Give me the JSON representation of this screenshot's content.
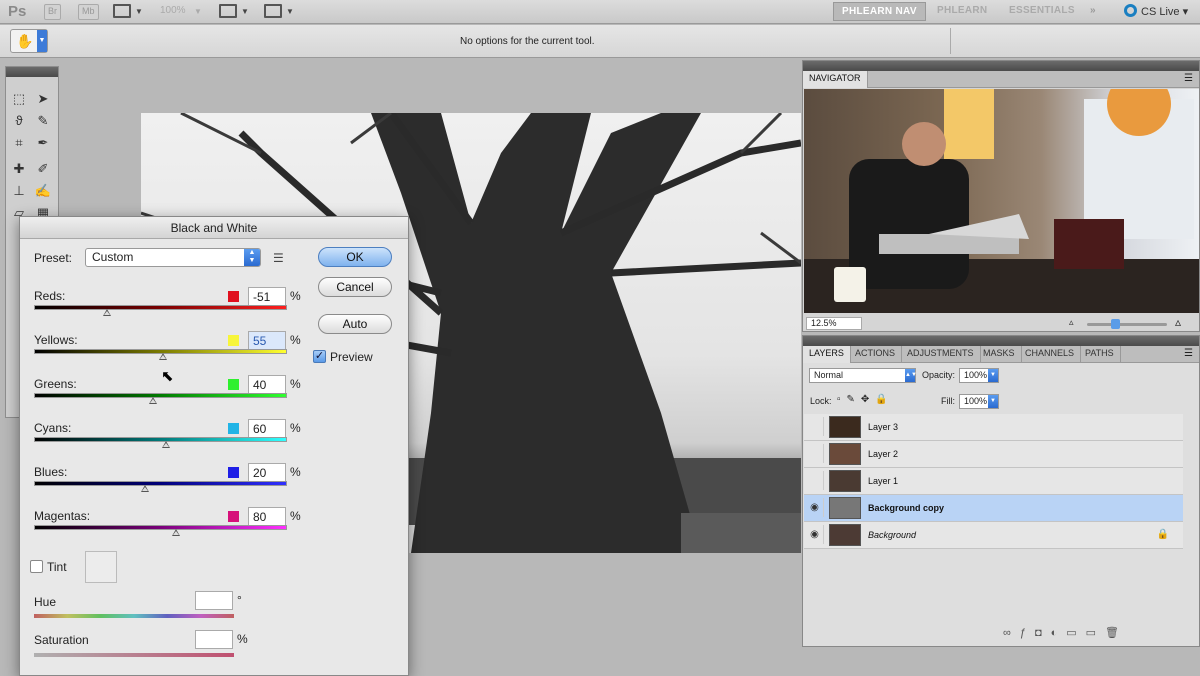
{
  "app": {
    "logo": "Ps",
    "bridge_label": "Br",
    "mini_bridge_label": "Mb",
    "zoom": "100%",
    "workspaces": [
      "PHLEARN NAV",
      "PHLEARN",
      "ESSENTIALS"
    ],
    "cs_live": "CS Live"
  },
  "options_bar": {
    "message": "No options for the current tool."
  },
  "dialog": {
    "title": "Black and White",
    "preset_label": "Preset:",
    "preset_value": "Custom",
    "ok_label": "OK",
    "cancel_label": "Cancel",
    "auto_label": "Auto",
    "preview_label": "Preview",
    "preview_checked": true,
    "sliders": [
      {
        "name": "Reds:",
        "value": "-51",
        "unit": "%",
        "color": "#e0101e",
        "position": 0.29
      },
      {
        "name": "Yellows:",
        "value": "55",
        "unit": "%",
        "color": "#f7f53a",
        "position": 0.51
      },
      {
        "name": "Greens:",
        "value": "40",
        "unit": "%",
        "color": "#2ef02e",
        "position": 0.47
      },
      {
        "name": "Cyans:",
        "value": "60",
        "unit": "%",
        "color": "#21b4e6",
        "position": 0.52
      },
      {
        "name": "Blues:",
        "value": "20",
        "unit": "%",
        "color": "#1e1ee6",
        "position": 0.44
      },
      {
        "name": "Magentas:",
        "value": "80",
        "unit": "%",
        "color": "#d6107a",
        "position": 0.56
      }
    ],
    "tint_label": "Tint",
    "tint_checked": false,
    "hue_label": "Hue",
    "hue_unit": "°",
    "saturation_label": "Saturation",
    "saturation_unit": "%"
  },
  "navigator": {
    "tab": "NAVIGATOR",
    "zoom": "12.5%"
  },
  "layers_panel": {
    "tabs": [
      "LAYERS",
      "ACTIONS",
      "ADJUSTMENTS",
      "MASKS",
      "CHANNELS",
      "PATHS"
    ],
    "blend_mode": "Normal",
    "opacity_label": "Opacity:",
    "opacity": "100%",
    "lock_label": "Lock:",
    "fill_label": "Fill:",
    "fill": "100%",
    "layers": [
      {
        "name": "Layer 3",
        "visible": false,
        "selected": false
      },
      {
        "name": "Layer 2",
        "visible": false,
        "selected": false
      },
      {
        "name": "Layer 1",
        "visible": false,
        "selected": false
      },
      {
        "name": "Background copy",
        "visible": true,
        "selected": true
      },
      {
        "name": "Background",
        "visible": true,
        "selected": false,
        "locked": true
      }
    ]
  }
}
